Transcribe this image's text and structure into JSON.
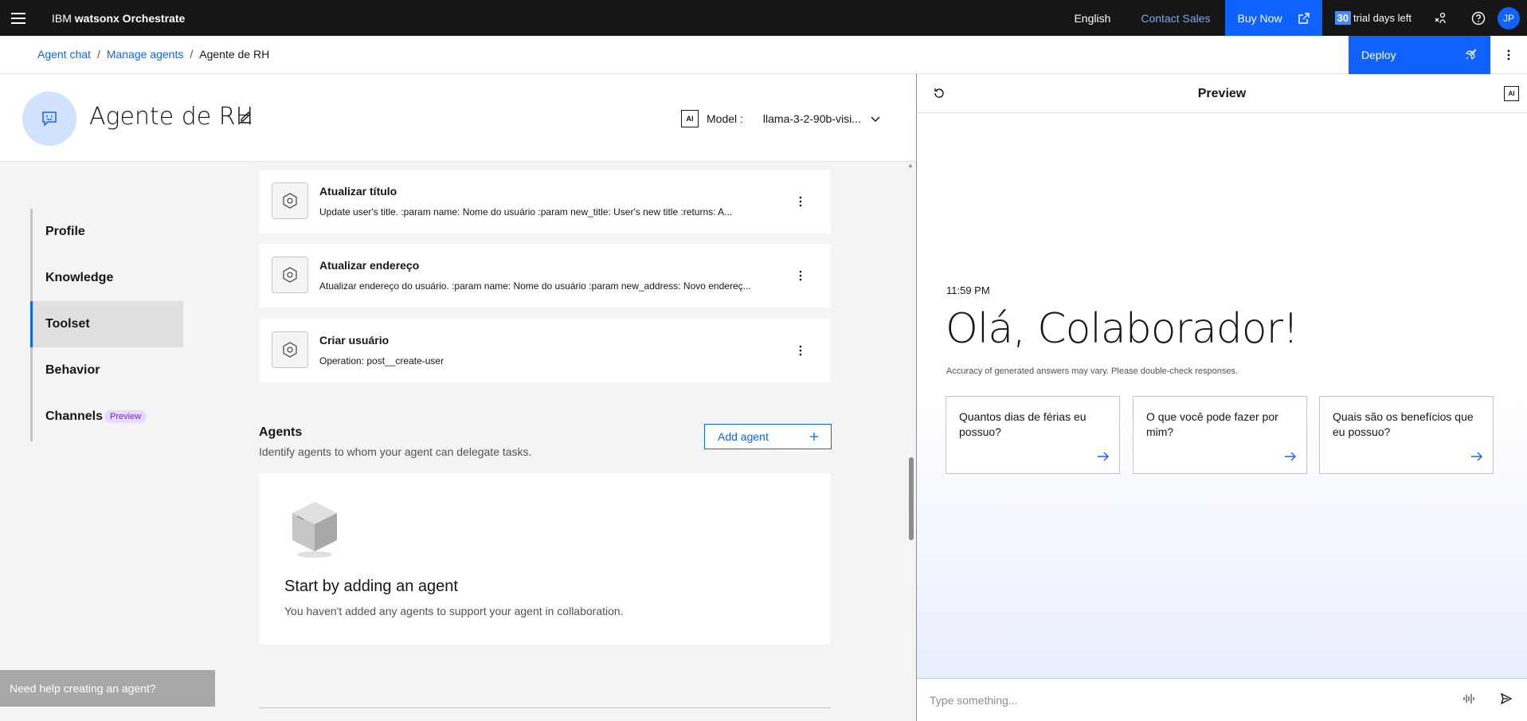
{
  "topbar": {
    "brand_prefix": "IBM ",
    "brand_name": "watsonx Orchestrate",
    "language": "English",
    "contact_sales": "Contact Sales",
    "buy_now": "Buy Now",
    "trial_days": "30",
    "trial_text": "trial days left",
    "avatar_initials": "JP"
  },
  "breadcrumb": {
    "items": [
      "Agent chat",
      "Manage agents",
      "Agente de RH"
    ],
    "separator": "/"
  },
  "deploy_label": "Deploy",
  "agent": {
    "name": "Agente de RH",
    "model_label": "Model :",
    "ai_badge": "AI",
    "model_value": "llama-3-2-90b-visi..."
  },
  "sidenav": {
    "items": [
      {
        "label": "Profile"
      },
      {
        "label": "Knowledge"
      },
      {
        "label": "Toolset",
        "active": true
      },
      {
        "label": "Behavior"
      },
      {
        "label": "Channels",
        "tag": "Preview"
      }
    ]
  },
  "tools": [
    {
      "title": "Atualizar título",
      "desc": "Update user's title. :param name: Nome do usuário :param new_title: User's new title :returns: A..."
    },
    {
      "title": "Atualizar endereço",
      "desc": "Atualizar endereço do usuário. :param name: Nome do usuário :param new_address: Novo endereç..."
    },
    {
      "title": "Criar usuário",
      "desc": "Operation: post__create-user"
    }
  ],
  "agents_section": {
    "title": "Agents",
    "subtitle": "Identify agents to whom your agent can delegate tasks.",
    "add_button": "Add agent",
    "empty_title": "Start by adding an agent",
    "empty_subtitle": "You haven't added any agents to support your agent in collaboration."
  },
  "help_button": "Need help creating an agent?",
  "preview": {
    "title": "Preview",
    "ai_badge": "AI",
    "time": "11:59 PM",
    "greeting": "Olá, Colaborador!",
    "disclaimer": "Accuracy of generated answers may vary. Please double-check responses.",
    "suggestions": [
      "Quantos dias de férias eu possuo?",
      "O que você pode fazer por mim?",
      "Quais são os benefícios que eu possuo?"
    ],
    "input_placeholder": "Type something..."
  },
  "colors": {
    "primary": "#0f62fe",
    "topbar": "#161616",
    "avatar_bg": "#d0e2ff",
    "preview_tag_bg": "#e8daff"
  }
}
